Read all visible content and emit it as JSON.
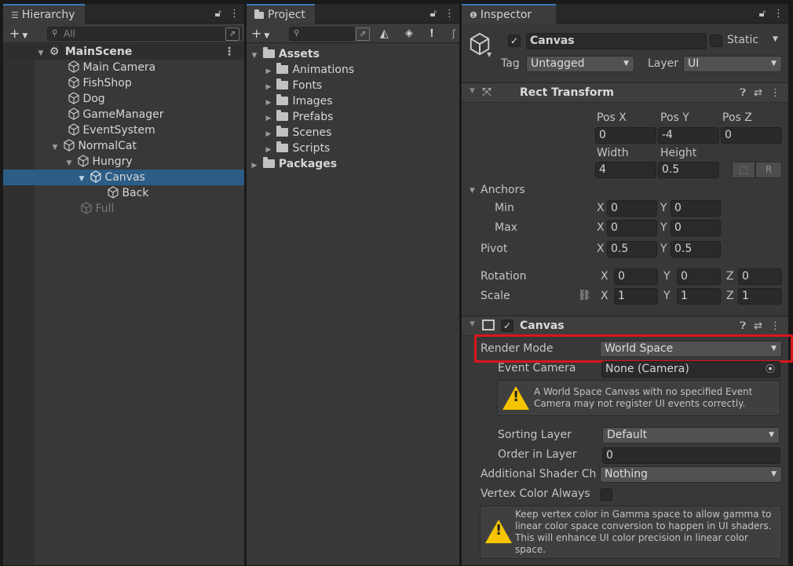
{
  "hierarchy": {
    "tab": "Hierarchy",
    "search_placeholder": "All",
    "items": [
      {
        "label": "MainScene",
        "type": "scene"
      },
      {
        "label": "Main Camera"
      },
      {
        "label": "FishShop"
      },
      {
        "label": "Dog"
      },
      {
        "label": "GameManager"
      },
      {
        "label": "EventSystem"
      },
      {
        "label": "NormalCat"
      },
      {
        "label": "Hungry"
      },
      {
        "label": "Canvas"
      },
      {
        "label": "Back"
      },
      {
        "label": "Full"
      }
    ]
  },
  "project": {
    "tab": "Project",
    "root": "Assets",
    "folders": [
      "Animations",
      "Fonts",
      "Images",
      "Prefabs",
      "Scenes",
      "Scripts"
    ],
    "packages": "Packages"
  },
  "inspector": {
    "tab": "Inspector",
    "object_name": "Canvas",
    "static_label": "Static",
    "tag_label": "Tag",
    "tag_value": "Untagged",
    "layer_label": "Layer",
    "layer_value": "UI",
    "rect_transform": {
      "title": "Rect Transform",
      "pos_x_label": "Pos X",
      "pos_x": "0",
      "pos_y_label": "Pos Y",
      "pos_y": "-4",
      "pos_z_label": "Pos Z",
      "pos_z": "0",
      "width_label": "Width",
      "width": "4",
      "height_label": "Height",
      "height": "0.5",
      "raw_button": "R",
      "anchors_label": "Anchors",
      "min_label": "Min",
      "min_x": "0",
      "min_y": "0",
      "max_label": "Max",
      "max_x": "0",
      "max_y": "0",
      "pivot_label": "Pivot",
      "pivot_x": "0.5",
      "pivot_y": "0.5",
      "rotation_label": "Rotation",
      "rot_x": "0",
      "rot_y": "0",
      "rot_z": "0",
      "scale_label": "Scale",
      "scale_x": "1",
      "scale_y": "1",
      "scale_z": "1",
      "x": "X",
      "y": "Y",
      "z": "Z"
    },
    "canvas": {
      "title": "Canvas",
      "render_mode_label": "Render Mode",
      "render_mode_value": "World Space",
      "event_camera_label": "Event Camera",
      "event_camera_value": "None (Camera)",
      "warning_text": "A World Space Canvas with no specified Event Camera may not register UI events correctly.",
      "sorting_layer_label": "Sorting Layer",
      "sorting_layer_value": "Default",
      "order_in_layer_label": "Order in Layer",
      "order_in_layer_value": "0",
      "additional_shader_label": "Additional Shader Ch",
      "additional_shader_value": "Nothing",
      "vertex_color_label": "Vertex Color Always",
      "vertex_note": "Keep vertex color in Gamma space to allow gamma to linear color space conversion to happen in UI shaders. This will enhance UI color precision in linear color space."
    }
  }
}
